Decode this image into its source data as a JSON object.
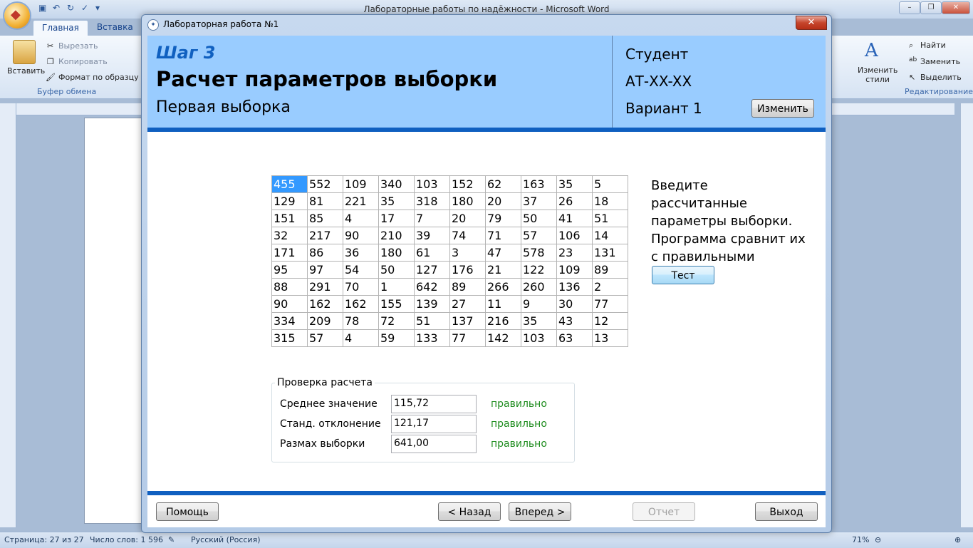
{
  "word": {
    "title": "Лабораторные работы по надёжности - Microsoft Word",
    "tabs": [
      "Главная",
      "Вставка"
    ],
    "clipboard": {
      "paste": "Вставить",
      "cut": "Вырезать",
      "copy": "Копировать",
      "format_painter": "Формат по образцу",
      "group": "Буфер обмена"
    },
    "styles": {
      "change": "Изменить стили"
    },
    "editing": {
      "find": "Найти",
      "replace": "Заменить",
      "select": "Выделить",
      "group": "Редактирование"
    },
    "status": {
      "page": "Страница: 27 из 27",
      "words": "Число слов: 1 596",
      "language": "Русский (Россия)",
      "zoom": "71%"
    }
  },
  "dialog": {
    "title": "Лабораторная работа №1",
    "step": "Шаг 3",
    "heading": "Расчет параметров выборки",
    "subheading": "Первая выборка",
    "student": "Студент",
    "group_code": "АТ-XX-XX",
    "variant": "Вариант 1",
    "change_button": "Изменить",
    "hint": "Введите рассчитанные параметры выборки. Программа сравнит их с правильными",
    "test_button": "Тест",
    "sample": [
      [
        "455",
        "552",
        "109",
        "340",
        "103",
        "152",
        "62",
        "163",
        "35",
        "5"
      ],
      [
        "129",
        "81",
        "221",
        "35",
        "318",
        "180",
        "20",
        "37",
        "26",
        "18"
      ],
      [
        "151",
        "85",
        "4",
        "17",
        "7",
        "20",
        "79",
        "50",
        "41",
        "51"
      ],
      [
        "32",
        "217",
        "90",
        "210",
        "39",
        "74",
        "71",
        "57",
        "106",
        "14"
      ],
      [
        "171",
        "86",
        "36",
        "180",
        "61",
        "3",
        "47",
        "578",
        "23",
        "131"
      ],
      [
        "95",
        "97",
        "54",
        "50",
        "127",
        "176",
        "21",
        "122",
        "109",
        "89"
      ],
      [
        "88",
        "291",
        "70",
        "1",
        "642",
        "89",
        "266",
        "260",
        "136",
        "2"
      ],
      [
        "90",
        "162",
        "162",
        "155",
        "139",
        "27",
        "11",
        "9",
        "30",
        "77"
      ],
      [
        "334",
        "209",
        "78",
        "72",
        "51",
        "137",
        "216",
        "35",
        "43",
        "12"
      ],
      [
        "315",
        "57",
        "4",
        "59",
        "133",
        "77",
        "142",
        "103",
        "63",
        "13"
      ]
    ],
    "check": {
      "title": "Проверка расчета",
      "rows": [
        {
          "label": "Среднее значение",
          "value": "115,72",
          "result": "правильно"
        },
        {
          "label": "Станд. отклонение",
          "value": "121,17",
          "result": "правильно"
        },
        {
          "label": "Размах выборки",
          "value": "641,00",
          "result": "правильно"
        }
      ]
    },
    "buttons": {
      "help": "Помощь",
      "back": "< Назад",
      "next": "Вперед >",
      "report": "Отчет",
      "exit": "Выход"
    }
  }
}
